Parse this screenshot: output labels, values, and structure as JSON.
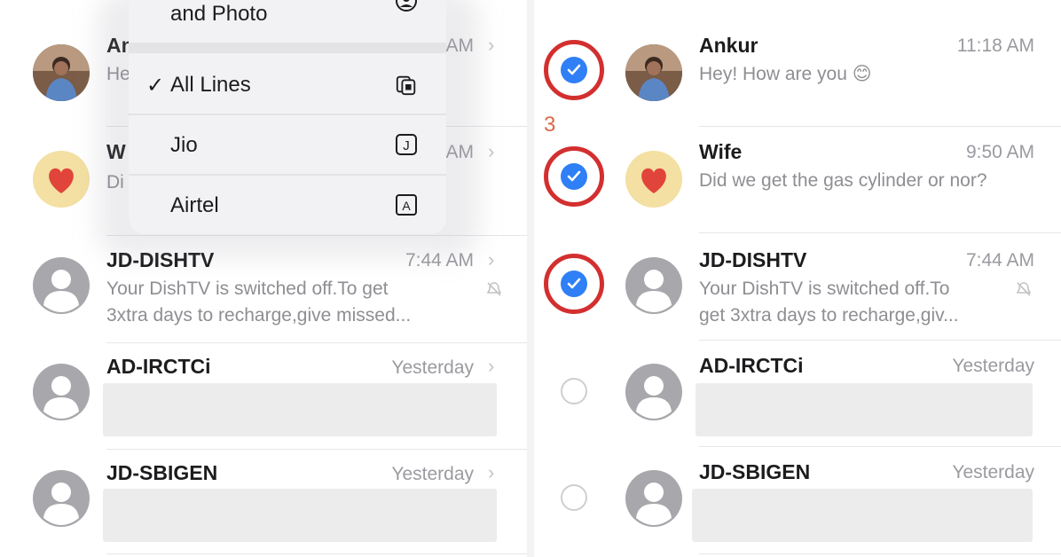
{
  "left": {
    "rows": [
      {
        "name": "An",
        "preview": "He",
        "time": "AM"
      },
      {
        "name": "W",
        "preview": "Di",
        "time": "AM"
      },
      {
        "name": "JD-DISHTV",
        "preview_line1": "Your DishTV is switched off.To get",
        "preview_line2": "3xtra days to recharge,give missed...",
        "time": "7:44 AM"
      },
      {
        "name": "AD-IRCTCi",
        "time": "Yesterday"
      },
      {
        "name": "JD-SBIGEN",
        "time": "Yesterday"
      }
    ]
  },
  "menu": {
    "items": [
      {
        "label": "and Photo",
        "icon": "contact-icon",
        "checked": false
      },
      {
        "label": "All Lines",
        "icon": "sim-cards-icon",
        "checked": true
      },
      {
        "label": "Jio",
        "icon": "sim-j-icon",
        "checked": false
      },
      {
        "label": "Airtel",
        "icon": "sim-a-icon",
        "checked": false
      }
    ],
    "checkmark": "✓",
    "sim_j_letter": "J",
    "sim_a_letter": "A"
  },
  "right": {
    "step_label": "3",
    "rows": [
      {
        "name": "Ankur",
        "preview": "Hey! How are you 😊",
        "time": "11:18 AM",
        "selected": true
      },
      {
        "name": "Wife",
        "preview": "Did we get the gas cylinder or nor?",
        "time": "9:50 AM",
        "selected": true
      },
      {
        "name": "JD-DISHTV",
        "preview_line1": "Your DishTV is switched off.To",
        "preview_line2": "get 3xtra days to recharge,giv...",
        "time": "7:44 AM",
        "selected": true
      },
      {
        "name": "AD-IRCTCi",
        "time": "Yesterday",
        "selected": false
      },
      {
        "name": "JD-SBIGEN",
        "time": "Yesterday",
        "selected": false
      }
    ]
  },
  "chevron": "›",
  "colors": {
    "accent_blue": "#2f7ff6",
    "highlight_red": "#d32f2f",
    "step_number": "#d9694a"
  }
}
